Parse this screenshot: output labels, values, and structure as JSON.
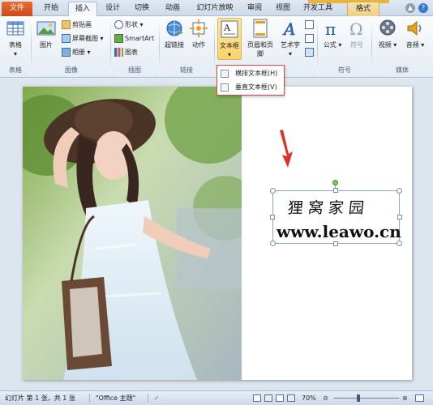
{
  "tabs": {
    "file": "文件",
    "home": "开始",
    "insert": "插入",
    "design": "设计",
    "transitions": "切换",
    "animations": "动画",
    "slideshow": "幻灯片放映",
    "review": "审阅",
    "view": "视图",
    "developer": "开发工具",
    "format": "格式"
  },
  "ribbon": {
    "table": "表格",
    "picture": "图片",
    "clipart": "剪贴画",
    "screenshot": "屏幕截图",
    "album": "相册",
    "shapes": "形状",
    "smartart": "SmartArt",
    "chart": "图表",
    "hyperlink": "超链接",
    "action": "动作",
    "textbox": "文本框",
    "header_footer": "页眉和页脚",
    "wordart": "艺术字",
    "equation": "公式",
    "symbol": "符号",
    "video": "视频",
    "audio": "音频",
    "groups": {
      "tables": "表格",
      "images": "图像",
      "illustrations": "插图",
      "links": "链接",
      "text": "文本",
      "symbols": "符号",
      "media": "媒体"
    }
  },
  "dropdown": {
    "horizontal": "横排文本框(H)",
    "vertical": "垂直文本框(V)"
  },
  "slide": {
    "text_chinese": "狸窝家园",
    "text_url": "www.leawo.cn"
  },
  "status": {
    "slide_info": "幻灯片 第 1 张，共 1 张",
    "theme": "\"Office 主题\"",
    "zoom": "70%"
  },
  "colors": {
    "file_tab": "#d2501f",
    "arrow": "#e0302a",
    "dropdown_border": "#e0473a"
  }
}
